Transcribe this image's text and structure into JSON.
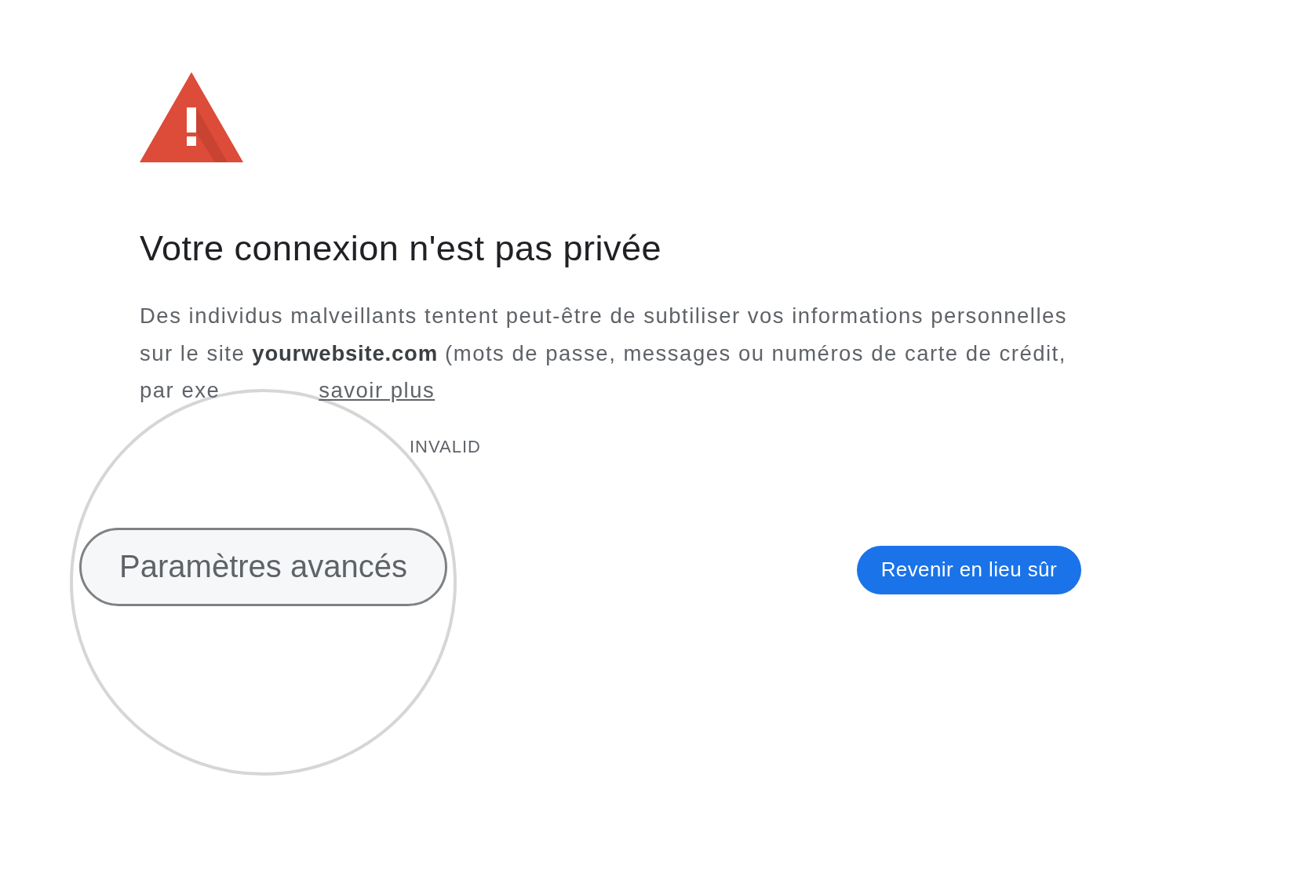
{
  "title": "Votre connexion n'est pas privée",
  "message": {
    "lines": [
      "Des individus malveillants tentent peut-être de subtiliser vos informations personnelles",
      "sur le site **yourwebsite.com** (mots de passe, messages ou numéros de carte de crédit,",
      "par exe"
    ],
    "link": "savoir plus"
  },
  "error_code": "INVALID",
  "magnifier": {
    "button": "Paramètres avancés"
  },
  "primary_button": "Revenir en lieu sûr"
}
